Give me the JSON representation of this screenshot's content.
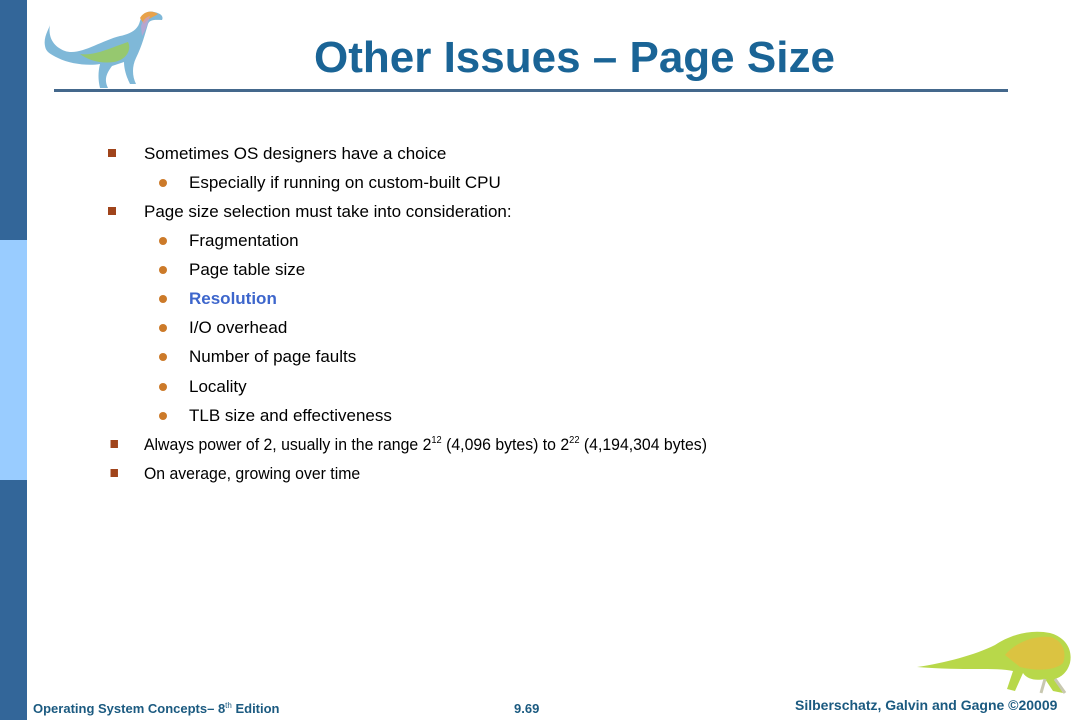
{
  "slide": {
    "title": "Other Issues – Page Size",
    "colors": {
      "title": "#1a6496",
      "side_bar_dark": "#336699",
      "side_bar_light": "#99ccff",
      "bullet_square": "#a0441b",
      "bullet_dot": "#cc7a29",
      "highlight_text": "#3d66cc",
      "footer_text": "#1b5a80"
    },
    "bullets": [
      {
        "level": 1,
        "text": "Sometimes OS designers have a choice"
      },
      {
        "level": 2,
        "text": "Especially if running on custom-built CPU"
      },
      {
        "level": 1,
        "text": "Page size selection must take into consideration:"
      },
      {
        "level": 2,
        "text": "Fragmentation"
      },
      {
        "level": 2,
        "text": "Page table size"
      },
      {
        "level": 2,
        "text": "Resolution",
        "highlight": true
      },
      {
        "level": 2,
        "text": "I/O overhead"
      },
      {
        "level": 2,
        "text": "Number of page faults"
      },
      {
        "level": 2,
        "text": "Locality"
      },
      {
        "level": 2,
        "text": "TLB size and effectiveness"
      },
      {
        "level": 1,
        "text_parts": {
          "a": "Always power of 2, usually in the range 2",
          "exp1": "12",
          "b": " (4,096 bytes) to 2",
          "exp2": "22",
          "c": " (4,194,304 bytes)"
        }
      },
      {
        "level": 1,
        "text": "On average, growing over time"
      }
    ],
    "icons": {
      "top_left": "dinosaur-icon",
      "bottom_right": "dinosaur-icon"
    }
  },
  "footer": {
    "book": "Operating System Concepts– 8",
    "book_sup": "th",
    "edition": " Edition",
    "page": "9.69",
    "copyright": "Silberschatz, Galvin and Gagne ©20009"
  }
}
